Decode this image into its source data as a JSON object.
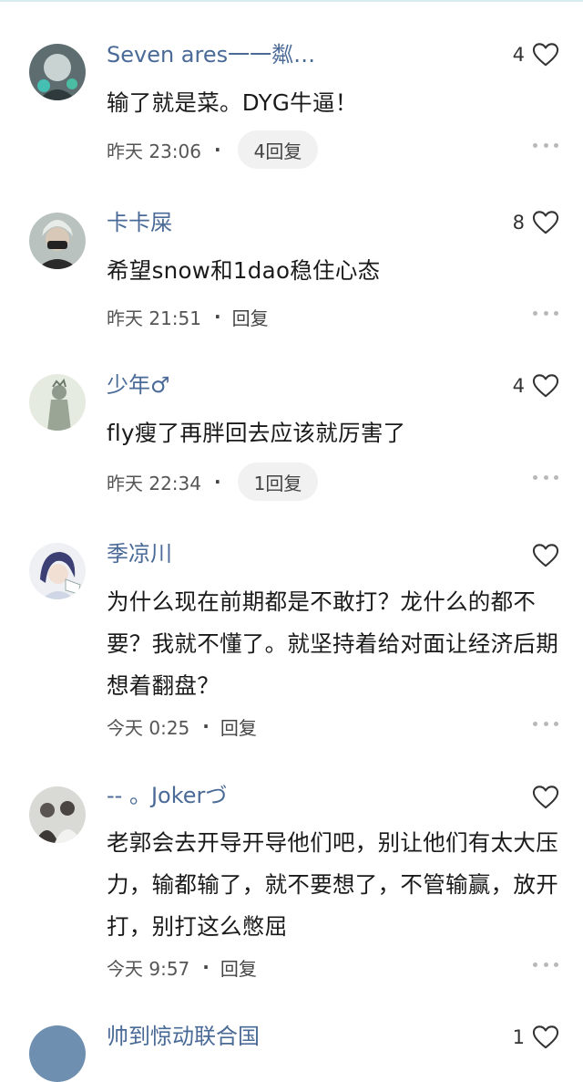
{
  "comments": [
    {
      "username": "Seven ares一一粼…",
      "likes": "4",
      "text": "输了就是菜。DYG牛逼！",
      "time": "昨天 23:06",
      "reply_label": "4回复"
    },
    {
      "username": "卡卡屎",
      "likes": "8",
      "text": "希望snow和1dao稳住心态",
      "time": "昨天 21:51",
      "reply_label": "回复"
    },
    {
      "username": "少年♂",
      "likes": "4",
      "text": "fly瘦了再胖回去应该就厉害了",
      "time": "昨天 22:34",
      "reply_label": "1回复"
    },
    {
      "username": "季凉川",
      "likes": "",
      "text": "为什么现在前期都是不敢打？龙什么的都不要？我就不懂了。就坚持着给对面让经济后期想着翻盘？",
      "time": "今天 0:25",
      "reply_label": "回复"
    },
    {
      "username": "-- 。Jokerづ",
      "likes": "",
      "text": "老郭会去开导开导他们吧，别让他们有太大压力，输都输了，就不要想了，不管输赢，放开打，别打这么憋屈",
      "time": "今天 9:57",
      "reply_label": "回复"
    },
    {
      "username": "帅到惊动联合国",
      "likes": "1",
      "text": "",
      "time": "",
      "reply_label": ""
    }
  ],
  "icons": {
    "like": "heart-outline-icon",
    "more": "more-horizontal-icon"
  },
  "colors": {
    "username": "#4a6a97",
    "body_text": "#1a1a1a",
    "meta_text": "#555555",
    "pill_bg": "#f1f1f1",
    "dots": "#b8b8b8"
  }
}
